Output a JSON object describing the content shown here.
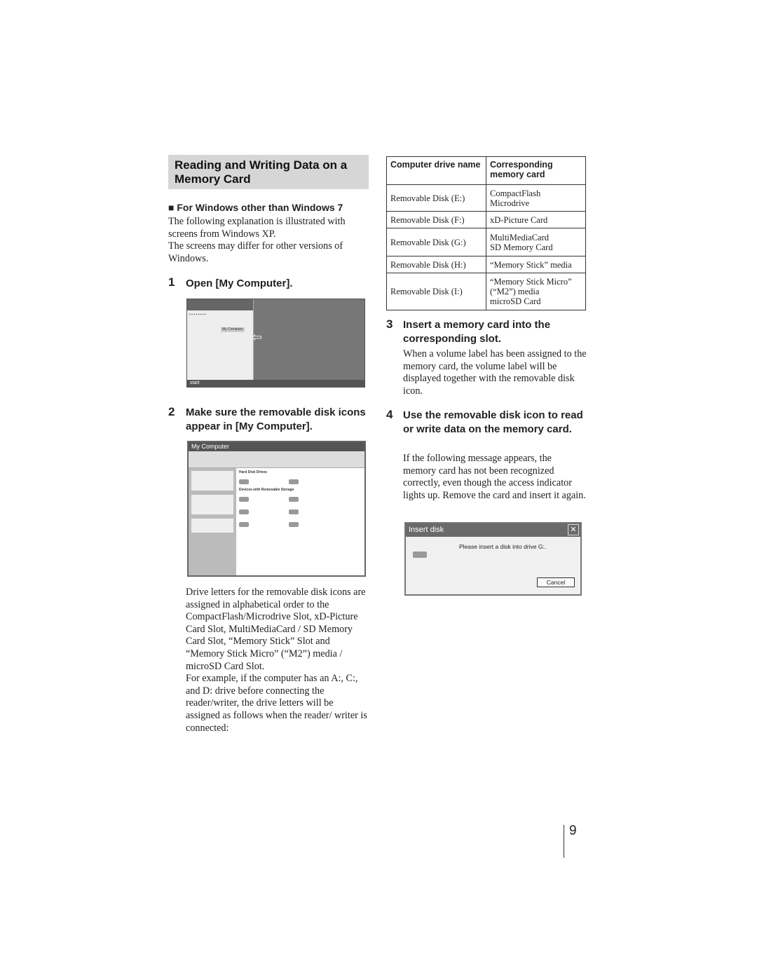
{
  "section_title": "Reading and Writing Data on a Memory Card",
  "subsection": "For Windows other than Windows 7",
  "intro": [
    "The following explanation is illustrated with screens from Windows XP.",
    "The screens may differ for other versions of Windows."
  ],
  "steps": [
    {
      "num": "1",
      "title": "Open [My Computer]."
    },
    {
      "num": "2",
      "title": "Make sure the removable disk icons appear in [My Computer].",
      "text": [
        "Drive letters for the removable disk icons are assigned in alphabetical order to the CompactFlash/Microdrive Slot, xD-Picture Card Slot, MultiMediaCard / SD Memory Card Slot, “Memory Stick” Slot and “Memory Stick Micro” (“M2”) media / microSD Card Slot.",
        "For example, if the computer has an A:, C:, and D: drive before connecting the reader/writer, the drive letters will be assigned as follows when the reader/ writer is connected:"
      ]
    },
    {
      "num": "3",
      "title": "Insert a memory card into the corresponding slot.",
      "text": "When a volume label has been assigned to the memory card, the volume label will be displayed together with the removable disk icon."
    },
    {
      "num": "4",
      "title": "Use the removable disk icon to read or write data on the memory card.",
      "text": "If the following message appears, the memory card has not been recognized correctly, even though the access indicator lights up. Remove the card and insert it again."
    }
  ],
  "table": {
    "headers": [
      "Computer drive name",
      "Corresponding memory card"
    ],
    "rows": [
      [
        "Removable Disk (E:)",
        "CompactFlash\nMicrodrive"
      ],
      [
        "Removable Disk (F:)",
        "xD-Picture Card"
      ],
      [
        "Removable Disk (G:)",
        "MultiMediaCard\nSD Memory Card"
      ],
      [
        "Removable Disk (H:)",
        "“Memory Stick” media"
      ],
      [
        "Removable Disk (I:)",
        "“Memory Stick Micro”\n(“M2”) media\nmicroSD Card"
      ]
    ]
  },
  "xp_start": {
    "start": "start",
    "highlight": "My Computer"
  },
  "my_computer": {
    "title": "My Computer",
    "group1": "Hard Disk Drives",
    "group2": "Devices with Removable Storage"
  },
  "dialog": {
    "title": "Insert disk",
    "message": "Please insert a disk into drive G:.",
    "cancel": "Cancel",
    "close": "✕"
  },
  "page_number": "9"
}
